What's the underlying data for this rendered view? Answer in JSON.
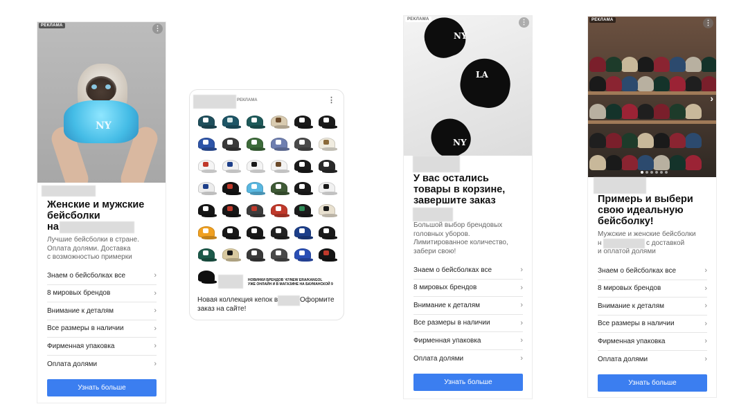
{
  "ad_label": "РЕКЛАМА",
  "more_glyph": "⋮",
  "chevron_glyph": "›",
  "next_glyph": "›",
  "ad1": {
    "headline_1": "Женские и мужские",
    "headline_2": "бейсболки",
    "headline_3": "на",
    "desc_1": "Лучшие бейсболки в стране.",
    "desc_2": "Оплата долями. Доставка",
    "desc_3": "с возможностью примерки",
    "hat_logo": "NY",
    "links": [
      "Знаем о бейсболках все",
      "8 мировых брендов",
      "Внимание к деталям",
      "Все размеры в наличии",
      "Фирменная упаковка",
      "Оплата долями"
    ],
    "cta": "Узнать больше"
  },
  "ad2": {
    "promo_1": "НОВИНКИ БРЕНДОВ '47/NEW ERA/KANGOL",
    "promo_2": "УЖЕ ОНЛАЙН И В МАГАЗИНЕ НА БАУМАНСКОЙ 9",
    "caption_1": "Новая коллекция кепок в",
    "caption_2": "Оформите",
    "caption_3": "заказ на сайте!",
    "cap_colors": [
      "#1f4f5c",
      "#1d5566",
      "#1e5a5a",
      "#d9cbb0",
      "#1a1a1a",
      "#1b1b1b",
      "#2e55a8",
      "#3a3a3a",
      "#3d6b3a",
      "#6f7fb0",
      "#4a4a4a",
      "#f0ece0",
      "#f5f5f5",
      "#f2f2f2",
      "#f4f4f4",
      "#f3f3f3",
      "#1a1a1a",
      "#2a2a2a",
      "#ececec",
      "#141414",
      "#59b7e0",
      "#3f5a36",
      "#1b1b1b",
      "#f1f1f1",
      "#161616",
      "#171717",
      "#3c3c3c",
      "#c0392b",
      "#1c1c1c",
      "#e8e0cf",
      "#f0a020",
      "#181818",
      "#1a1a1a",
      "#222222",
      "#1d3f8a",
      "#1a1a1a",
      "#1c5a4a",
      "#d8c9a0",
      "#3a3a3a",
      "#4a4a4a",
      "#2a4fb5",
      "#151515",
      "#101010",
      "#1a1a1a",
      "#1a1a1a",
      "#1a1a1a",
      "#1a1a1a",
      "#1a1a1a"
    ],
    "mark_colors": [
      "#ffffff",
      "#d8e8e8",
      "#ffffff",
      "#6b4a2a",
      "#ffffff",
      "#ffffff",
      "#ffffff",
      "#ffffff",
      "#ffffff",
      "#ffffff",
      "#ffffff",
      "#8a6a3a",
      "#c0392b",
      "#1d3f8a",
      "#1a1a1a",
      "#6b4a2a",
      "#ffffff",
      "#ffffff",
      "#1d3f8a",
      "#c0392b",
      "#ffffff",
      "#ffffff",
      "#ffffff",
      "#1a1a1a",
      "#ffffff",
      "#c0392b",
      "#c0392b",
      "#ffffff",
      "#2e8b57",
      "#1a1a1a",
      "#ffffff",
      "#ffffff",
      "#ffffff",
      "#ffffff",
      "#ffffff",
      "#ffffff",
      "#ffffff",
      "#1a1a1a",
      "#ffffff",
      "#ffffff",
      "#ffffff",
      "#c0392b",
      "#101010",
      "#1a1a1a",
      "#1a1a1a",
      "#1a1a1a",
      "#1a1a1a",
      "#1a1a1a"
    ]
  },
  "ad3": {
    "headline_1": "У вас остались",
    "headline_2": "товары в корзине,",
    "headline_3": "завершите заказ",
    "desc_1": "Большой выбор брендовых",
    "desc_2": "головных уборов.",
    "desc_3": "Лимитированное количество,",
    "desc_4": "забери свою!",
    "cap_logo_1": "NY",
    "cap_logo_2": "LA",
    "cap_logo_3": "NY",
    "links": [
      "Знаем о бейсболках все",
      "8 мировых брендов",
      "Внимание к деталям",
      "Все размеры в наличии",
      "Фирменная упаковка",
      "Оплата долями"
    ],
    "cta": "Узнать больше"
  },
  "ad4": {
    "headline_1": "Примерь и выбери",
    "headline_2": "свою идеальную",
    "headline_3": "бейсболку!",
    "desc_1": "Мужские и женские бейсболки",
    "desc_2": "н",
    "desc_2b": "с доставкой",
    "desc_3": "и оплатой долями",
    "links": [
      "Знаем о бейсболках все",
      "8 мировых брендов",
      "Внимание к деталям",
      "Все размеры в наличии",
      "Фирменная упаковка",
      "Оплата долями"
    ],
    "cta": "Узнать больше"
  }
}
